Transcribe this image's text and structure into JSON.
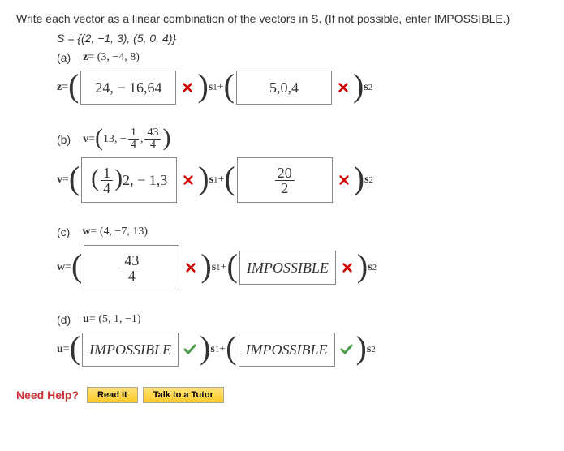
{
  "question": "Write each vector as a linear combination of the vectors in S. (If not possible, enter IMPOSSIBLE.)",
  "set_def": "S = {(2, −1, 3), (5, 0, 4)}",
  "parts": {
    "a": {
      "label": "(a)",
      "vector_label": "z",
      "vector_def": " = (3, −4, 8)",
      "eq_lhs": "z",
      "ans1": "24, − 16,64",
      "ans2": "5,0,4",
      "mark1": "x",
      "mark2": "x"
    },
    "b": {
      "label": "(b)",
      "vector_label": "v",
      "vector_def_pre": " = ",
      "def_num": "13, − ",
      "def_frac1_n": "1",
      "def_frac1_d": "4",
      "def_frac2_n": "43",
      "def_frac2_d": "4",
      "eq_lhs": "v",
      "ans1_frac_n": "1",
      "ans1_frac_d": "4",
      "ans1_tail": "2, − 1,3",
      "ans2_frac_n": "20",
      "ans2_frac_d": "2",
      "mark1": "x",
      "mark2": "x"
    },
    "c": {
      "label": "(c)",
      "vector_label": "w",
      "vector_def": " = (4, −7, 13)",
      "eq_lhs": "w",
      "ans1_frac_n": "43",
      "ans1_frac_d": "4",
      "ans2": "IMPOSSIBLE",
      "mark1": "x",
      "mark2": "x"
    },
    "d": {
      "label": "(d)",
      "vector_label": "u",
      "vector_def": " = (5, 1, −1)",
      "eq_lhs": "u",
      "ans1": "IMPOSSIBLE",
      "ans2": "IMPOSSIBLE",
      "mark1": "check",
      "mark2": "check"
    }
  },
  "s_label": "s",
  "plus": " + ",
  "eq": " = ",
  "help": {
    "label": "Need Help?",
    "read": "Read It",
    "tutor": "Talk to a Tutor"
  }
}
